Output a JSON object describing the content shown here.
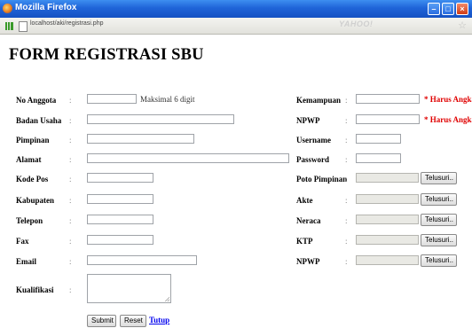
{
  "window": {
    "title": "Mozilla Firefox",
    "controls": [
      "–",
      "□",
      "×"
    ]
  },
  "browser": {
    "url": "localhost/aki/registrasi.php",
    "search_brand": "YAHOO!",
    "bookmark_icon": "star-icon"
  },
  "form": {
    "title": "FORM REGISTRASI SBU",
    "separator": ":",
    "left": {
      "no_anggota": {
        "label": "No Anggota",
        "value": "",
        "note": "Maksimal 6 digit"
      },
      "badan_usaha": {
        "label": "Badan Usaha",
        "value": ""
      },
      "pimpinan": {
        "label": "Pimpinan",
        "value": ""
      },
      "alamat": {
        "label": "Alamat",
        "value": ""
      },
      "kode_pos": {
        "label": "Kode Pos",
        "value": ""
      },
      "kabupaten": {
        "label": "Kabupaten",
        "value": ""
      },
      "telepon": {
        "label": "Telepon",
        "value": ""
      },
      "fax": {
        "label": "Fax",
        "value": ""
      },
      "email": {
        "label": "Email",
        "value": ""
      },
      "kualifikasi": {
        "label": "Kualifikasi",
        "value": ""
      }
    },
    "right": {
      "kemampuan": {
        "label": "Kemampuan",
        "value": "",
        "note": "* Harus Angka"
      },
      "npwp": {
        "label": "NPWP",
        "value": "",
        "note": "* Harus Angka"
      },
      "username": {
        "label": "Username",
        "value": ""
      },
      "password": {
        "label": "Password",
        "value": ""
      },
      "poto_pimpinan": {
        "label": "Poto Pimpinan",
        "button": "Telusuri.."
      },
      "akte": {
        "label": "Akte",
        "button": "Telusuri.."
      },
      "neraca": {
        "label": "Neraca",
        "button": "Telusuri.."
      },
      "ktp": {
        "label": "KTP",
        "button": "Telusuri.."
      },
      "npwp_file": {
        "label": "NPWP",
        "button": "Telusuri.."
      }
    },
    "actions": {
      "submit": "Submit",
      "reset": "Reset",
      "close_link": "Tutup"
    }
  },
  "colors": {
    "titlebar": "#1f64d8",
    "required_note": "#e00000",
    "link": "#0000ee"
  }
}
